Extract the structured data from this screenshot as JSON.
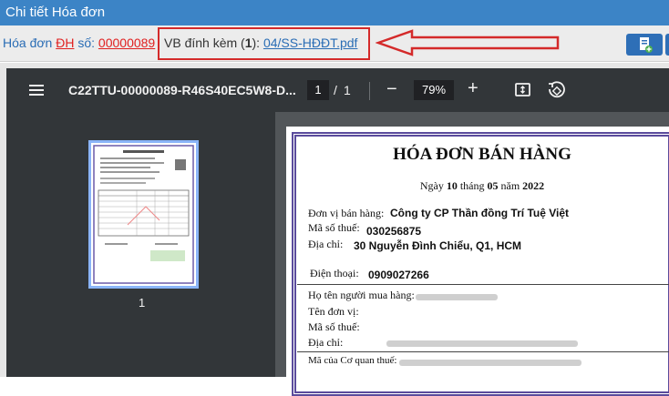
{
  "window": {
    "title": "Chi tiết Hóa đơn"
  },
  "invoice_bar": {
    "prefix": "Hóa đơn",
    "type_code": "ĐH",
    "number_label": "số:",
    "number": "00000089",
    "attach_label": "VB đính kèm (",
    "attach_count": "1",
    "attach_close": "):",
    "attach_file": "04/SS-HĐĐT.pdf"
  },
  "pdf_viewer": {
    "filename": "C22TTU-00000089-R46S40EC5W8-D...",
    "current_page": "1",
    "page_sep": "/",
    "total_pages": "1",
    "zoom": "79%",
    "thumbnail_label": "1"
  },
  "document": {
    "title": "HÓA ĐƠN BÁN HÀNG",
    "date_prefix": "Ngày",
    "day": "10",
    "month_label": "tháng",
    "month": "05",
    "year_label": "năm",
    "year": "2022",
    "seller_label": "Đơn vị bán hàng:",
    "seller_value": "Công ty CP Thần đồng Trí Tuệ Việt",
    "tax_label": "Mã số thuế:",
    "tax_value": "030256875",
    "address_label": "Địa chỉ:",
    "address_value": "30 Nguyễn Đình Chiểu, Q1, HCM",
    "phone_label": "Điện thoại:",
    "phone_value": "0909027266",
    "buyer_name_label": "Họ tên người mua hàng:",
    "buyer_unit_label": "Tên đơn vị:",
    "buyer_tax_label": "Mã số thuế:",
    "buyer_address_label": "Địa chỉ:",
    "agency_code_label": "Mã của Cơ quan thuế:"
  },
  "colors": {
    "titlebar": "#3c84c6",
    "highlight_red": "#d42a2a",
    "link": "#2a6db5"
  }
}
